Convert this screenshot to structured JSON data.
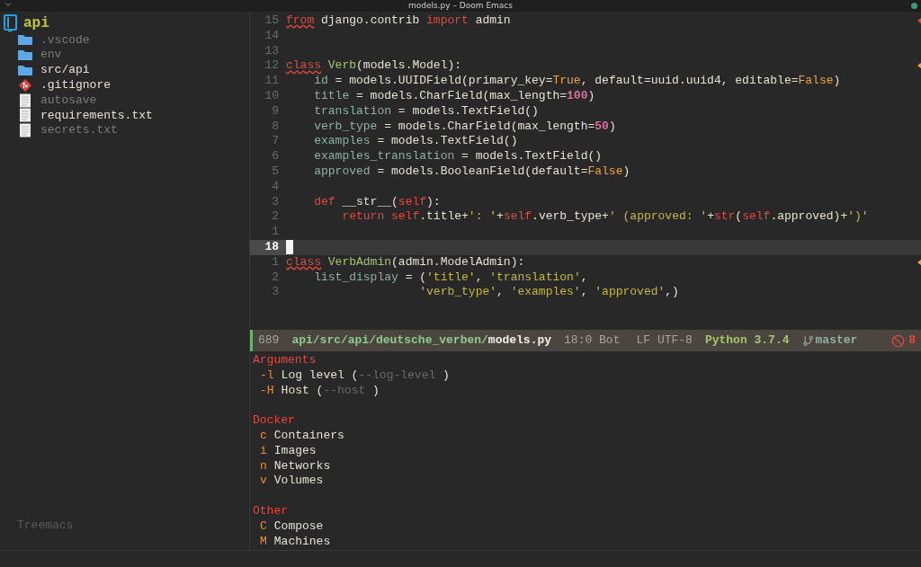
{
  "window": {
    "title": "models.py – Doom Emacs"
  },
  "sidebar": {
    "root": {
      "label": "api",
      "children": [
        {
          "label": ".vscode",
          "kind": "folder",
          "dimmed": true
        },
        {
          "label": "env",
          "kind": "folder",
          "dimmed": true
        },
        {
          "label": "src/api",
          "kind": "folder",
          "dimmed": false
        },
        {
          "label": ".gitignore",
          "kind": "git",
          "dimmed": false
        },
        {
          "label": "autosave",
          "kind": "file",
          "dimmed": true
        },
        {
          "label": "requirements.txt",
          "kind": "file",
          "dimmed": false
        },
        {
          "label": "secrets.txt",
          "kind": "file",
          "dimmed": true
        }
      ]
    },
    "footer": "Treemacs"
  },
  "editor": {
    "lines": [
      {
        "number": "15",
        "current": false,
        "color": "#e5483c",
        "tokens": [
          {
            "text": "from",
            "kind": "keyword",
            "warning": true
          },
          {
            "text": " django.contrib ",
            "kind": "plain"
          },
          {
            "text": "import",
            "kind": "keyword"
          },
          {
            "text": " admin",
            "kind": "plain"
          }
        ]
      },
      {
        "number": "14",
        "current": false
      },
      {
        "number": "13",
        "current": false
      },
      {
        "number": "12",
        "current": false,
        "color": "#f0a438",
        "tokens": [
          {
            "text": "class",
            "kind": "keyword",
            "warning": true
          },
          {
            "text": " Verb",
            "kind": "type"
          },
          {
            "text": "(models.Model):",
            "kind": "plain"
          }
        ]
      },
      {
        "number": "11",
        "current": false,
        "tokens": [
          {
            "text": "    id",
            "kind": "attr"
          },
          {
            "text": " = models.UUIDField(primary_key=",
            "kind": "plain"
          },
          {
            "text": "True",
            "kind": "constant"
          },
          {
            "text": ", default=uuid.uuid4, editable=",
            "kind": "plain"
          },
          {
            "text": "False",
            "kind": "constant"
          },
          {
            "text": ")",
            "kind": "plain"
          }
        ]
      },
      {
        "number": "10",
        "current": false,
        "tokens": [
          {
            "text": "    title",
            "kind": "attr"
          },
          {
            "text": " = models.CharField(max_length=",
            "kind": "plain"
          },
          {
            "text": "100",
            "kind": "number"
          },
          {
            "text": ")",
            "kind": "plain"
          }
        ]
      },
      {
        "number": "9",
        "current": false,
        "tokens": [
          {
            "text": "    translation",
            "kind": "attr"
          },
          {
            "text": " = models.TextField()",
            "kind": "plain"
          }
        ]
      },
      {
        "number": "8",
        "current": false,
        "tokens": [
          {
            "text": "    verb_type",
            "kind": "attr"
          },
          {
            "text": " = models.CharField(max_length=",
            "kind": "plain"
          },
          {
            "text": "50",
            "kind": "number"
          },
          {
            "text": ")",
            "kind": "plain"
          }
        ]
      },
      {
        "number": "7",
        "current": false,
        "tokens": [
          {
            "text": "    examples",
            "kind": "attr"
          },
          {
            "text": " = models.TextField()",
            "kind": "plain"
          }
        ]
      },
      {
        "number": "6",
        "current": false,
        "tokens": [
          {
            "text": "    examples_translation",
            "kind": "attr"
          },
          {
            "text": " = models.TextField()",
            "kind": "plain"
          }
        ]
      },
      {
        "number": "5",
        "current": false,
        "tokens": [
          {
            "text": "    approved",
            "kind": "attr"
          },
          {
            "text": " = models.BooleanField(default=",
            "kind": "plain"
          },
          {
            "text": "False",
            "kind": "constant"
          },
          {
            "text": ")",
            "kind": "plain"
          }
        ]
      },
      {
        "number": "4",
        "current": false
      },
      {
        "number": "3",
        "current": false,
        "tokens": [
          {
            "text": "    def",
            "kind": "keyword"
          },
          {
            "text": " __str__(",
            "kind": "plain"
          },
          {
            "text": "self",
            "kind": "keyword"
          },
          {
            "text": "):",
            "kind": "plain"
          }
        ]
      },
      {
        "number": "2",
        "current": false,
        "tokens": [
          {
            "text": "        return",
            "kind": "keyword"
          },
          {
            "text": " self",
            "kind": "keyword"
          },
          {
            "text": ".title+",
            "kind": "plain"
          },
          {
            "text": "': '",
            "kind": "string"
          },
          {
            "text": "+",
            "kind": "plain"
          },
          {
            "text": "self",
            "kind": "keyword"
          },
          {
            "text": ".verb_type+",
            "kind": "plain"
          },
          {
            "text": "' (approved: '",
            "kind": "string"
          },
          {
            "text": "+",
            "kind": "plain"
          },
          {
            "text": "str",
            "kind": "keyword"
          },
          {
            "text": "(",
            "kind": "plain"
          },
          {
            "text": "self",
            "kind": "keyword"
          },
          {
            "text": ".approved)+",
            "kind": "plain"
          },
          {
            "text": "')'",
            "kind": "string"
          }
        ]
      },
      {
        "number": "1",
        "current": false
      },
      {
        "number": "18",
        "current": true
      },
      {
        "number": "1",
        "current": false,
        "color": "#f0a438",
        "tokens": [
          {
            "text": "class",
            "kind": "keyword",
            "warning": true
          },
          {
            "text": " VerbAdmin",
            "kind": "type"
          },
          {
            "text": "(admin.ModelAdmin):",
            "kind": "plain"
          }
        ]
      },
      {
        "number": "2",
        "current": false,
        "tokens": [
          {
            "text": "    list_display",
            "kind": "attr"
          },
          {
            "text": " = (",
            "kind": "plain"
          },
          {
            "text": "'title'",
            "kind": "string"
          },
          {
            "text": ", ",
            "kind": "plain"
          },
          {
            "text": "'translation'",
            "kind": "string"
          },
          {
            "text": ",",
            "kind": "plain"
          }
        ]
      },
      {
        "number": "3",
        "current": false,
        "tokens": [
          {
            "text": "                   'verb_type'",
            "kind": "string"
          },
          {
            "text": ", ",
            "kind": "plain"
          },
          {
            "text": "'examples'",
            "kind": "string"
          },
          {
            "text": ", ",
            "kind": "plain"
          },
          {
            "text": "'approved'",
            "kind": "string"
          },
          {
            "text": ",)",
            "kind": "plain"
          }
        ]
      }
    ]
  },
  "modeline": {
    "size": "689",
    "directory": "api/src/api/deutsche_verben/",
    "filename": "models.py",
    "position": "18:0 Bot",
    "encoding": "LF UTF-8",
    "mode": "Python 3.7.4",
    "branch": "master",
    "errors": "8"
  },
  "transient": {
    "sections": [
      {
        "title": "Arguments",
        "items": [
          {
            "key": "-l",
            "label": "Log level (",
            "option": "--log-level",
            "close": " )"
          },
          {
            "key": "-H",
            "label": "Host (",
            "option": "--host",
            "close": " )"
          }
        ]
      },
      {
        "title": "Docker",
        "items": [
          {
            "key": "c",
            "label": "Containers"
          },
          {
            "key": "i",
            "label": "Images"
          },
          {
            "key": "n",
            "label": "Networks"
          },
          {
            "key": "v",
            "label": "Volumes"
          }
        ]
      },
      {
        "title": "Other",
        "items": [
          {
            "key": "C",
            "label": "Compose"
          },
          {
            "key": "M",
            "label": "Machines"
          }
        ]
      }
    ]
  }
}
